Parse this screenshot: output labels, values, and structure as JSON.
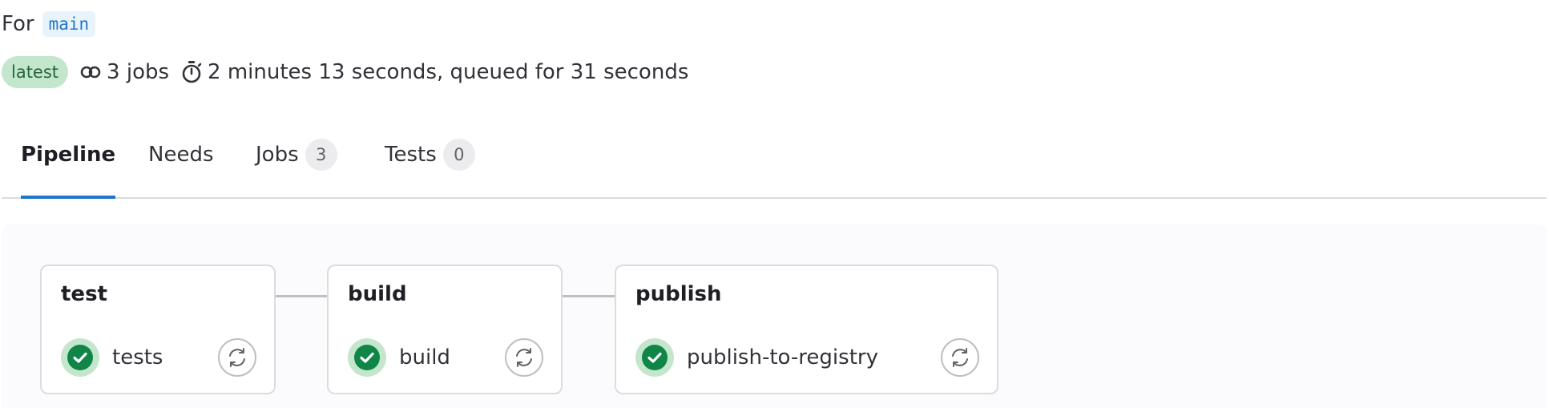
{
  "header": {
    "for_label": "For",
    "branch": "main",
    "badge": "latest",
    "jobs_text": "3 jobs",
    "duration_text": "2 minutes 13 seconds, queued for 31 seconds"
  },
  "icons": {
    "jobs": "pipeline-jobs-icon",
    "duration": "timer-icon",
    "status": "success-check-icon",
    "retry": "retry-icon"
  },
  "tabs": [
    {
      "label": "Pipeline",
      "active": true
    },
    {
      "label": "Needs"
    },
    {
      "label": "Jobs",
      "count": "3"
    },
    {
      "label": "Tests",
      "count": "0"
    }
  ],
  "stages": [
    {
      "title": "test",
      "job": "tests",
      "status": "success"
    },
    {
      "title": "build",
      "job": "build",
      "status": "success"
    },
    {
      "title": "publish",
      "job": "publish-to-registry",
      "status": "success"
    }
  ],
  "colors": {
    "accent": "#1f75cb",
    "success": "#108548",
    "success_bg": "#c3e6cd"
  }
}
